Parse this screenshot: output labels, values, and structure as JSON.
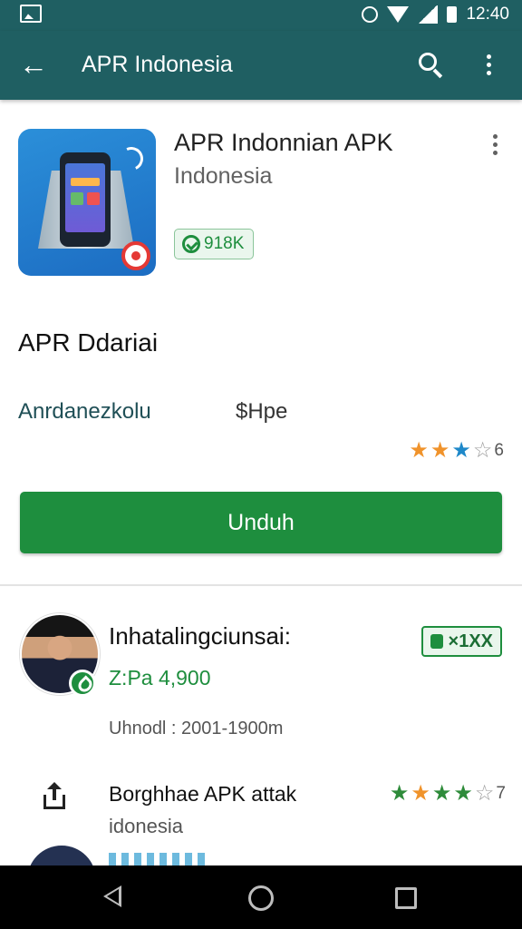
{
  "status_bar": {
    "time": "12:40",
    "icons": [
      "image-icon",
      "alarm-icon",
      "wifi-icon",
      "signal-icon",
      "battery-icon"
    ]
  },
  "app_bar": {
    "title": "APR Indonesia",
    "icons": [
      "back-arrow-icon",
      "search-icon",
      "overflow-menu-icon"
    ]
  },
  "app": {
    "name": "APR Indonnian APK",
    "developer": "Indonesia",
    "download_count": "918K",
    "section_title": "APR Ddariai",
    "meta_left": "Anrdanezkolu",
    "meta_right": "$Hpe",
    "rating_stars": 3,
    "rating_value": "6",
    "install_label": "Unduh"
  },
  "featured": {
    "name": "Inhatalingciunsai:",
    "price": "Z:Pa 4,900",
    "badge_label": "×1XX",
    "date": "Uhnodl : 2001-1900m"
  },
  "item": {
    "title": "Borghhae APK attak",
    "subtitle": "idonesia",
    "rating_stars": 4,
    "rating_value": "7"
  },
  "nav_bar": {
    "icons": [
      "nav-back-icon",
      "nav-home-icon",
      "nav-recents-icon"
    ]
  },
  "colors": {
    "app_bar": "#1f5f62",
    "accent_green": "#1e8e3e",
    "star_orange": "#f0932b",
    "star_blue": "#1e88c9"
  }
}
